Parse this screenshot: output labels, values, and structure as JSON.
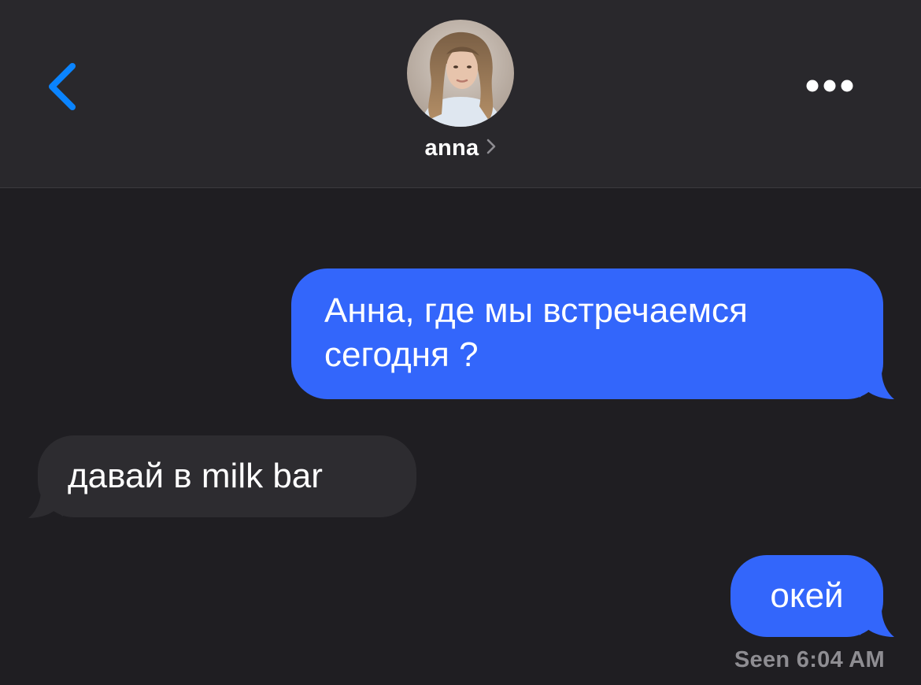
{
  "header": {
    "contact_name": "anna",
    "icons": {
      "back": "chevron-left-icon",
      "more": "more-icon",
      "contact_chevron": "chevron-right-icon"
    },
    "accent_color": "#0a84ff"
  },
  "messages": [
    {
      "direction": "outgoing",
      "text": "Анна, где мы встречаемся сегодня ?"
    },
    {
      "direction": "incoming",
      "text": "давай в milk bar"
    },
    {
      "direction": "outgoing",
      "text": "окей"
    }
  ],
  "status": {
    "seen": "Seen 6:04 AM"
  },
  "colors": {
    "outgoing_bubble": "#3366fb",
    "incoming_bubble": "#2d2c30",
    "background": "#1f1e22",
    "header": "#29282c"
  }
}
